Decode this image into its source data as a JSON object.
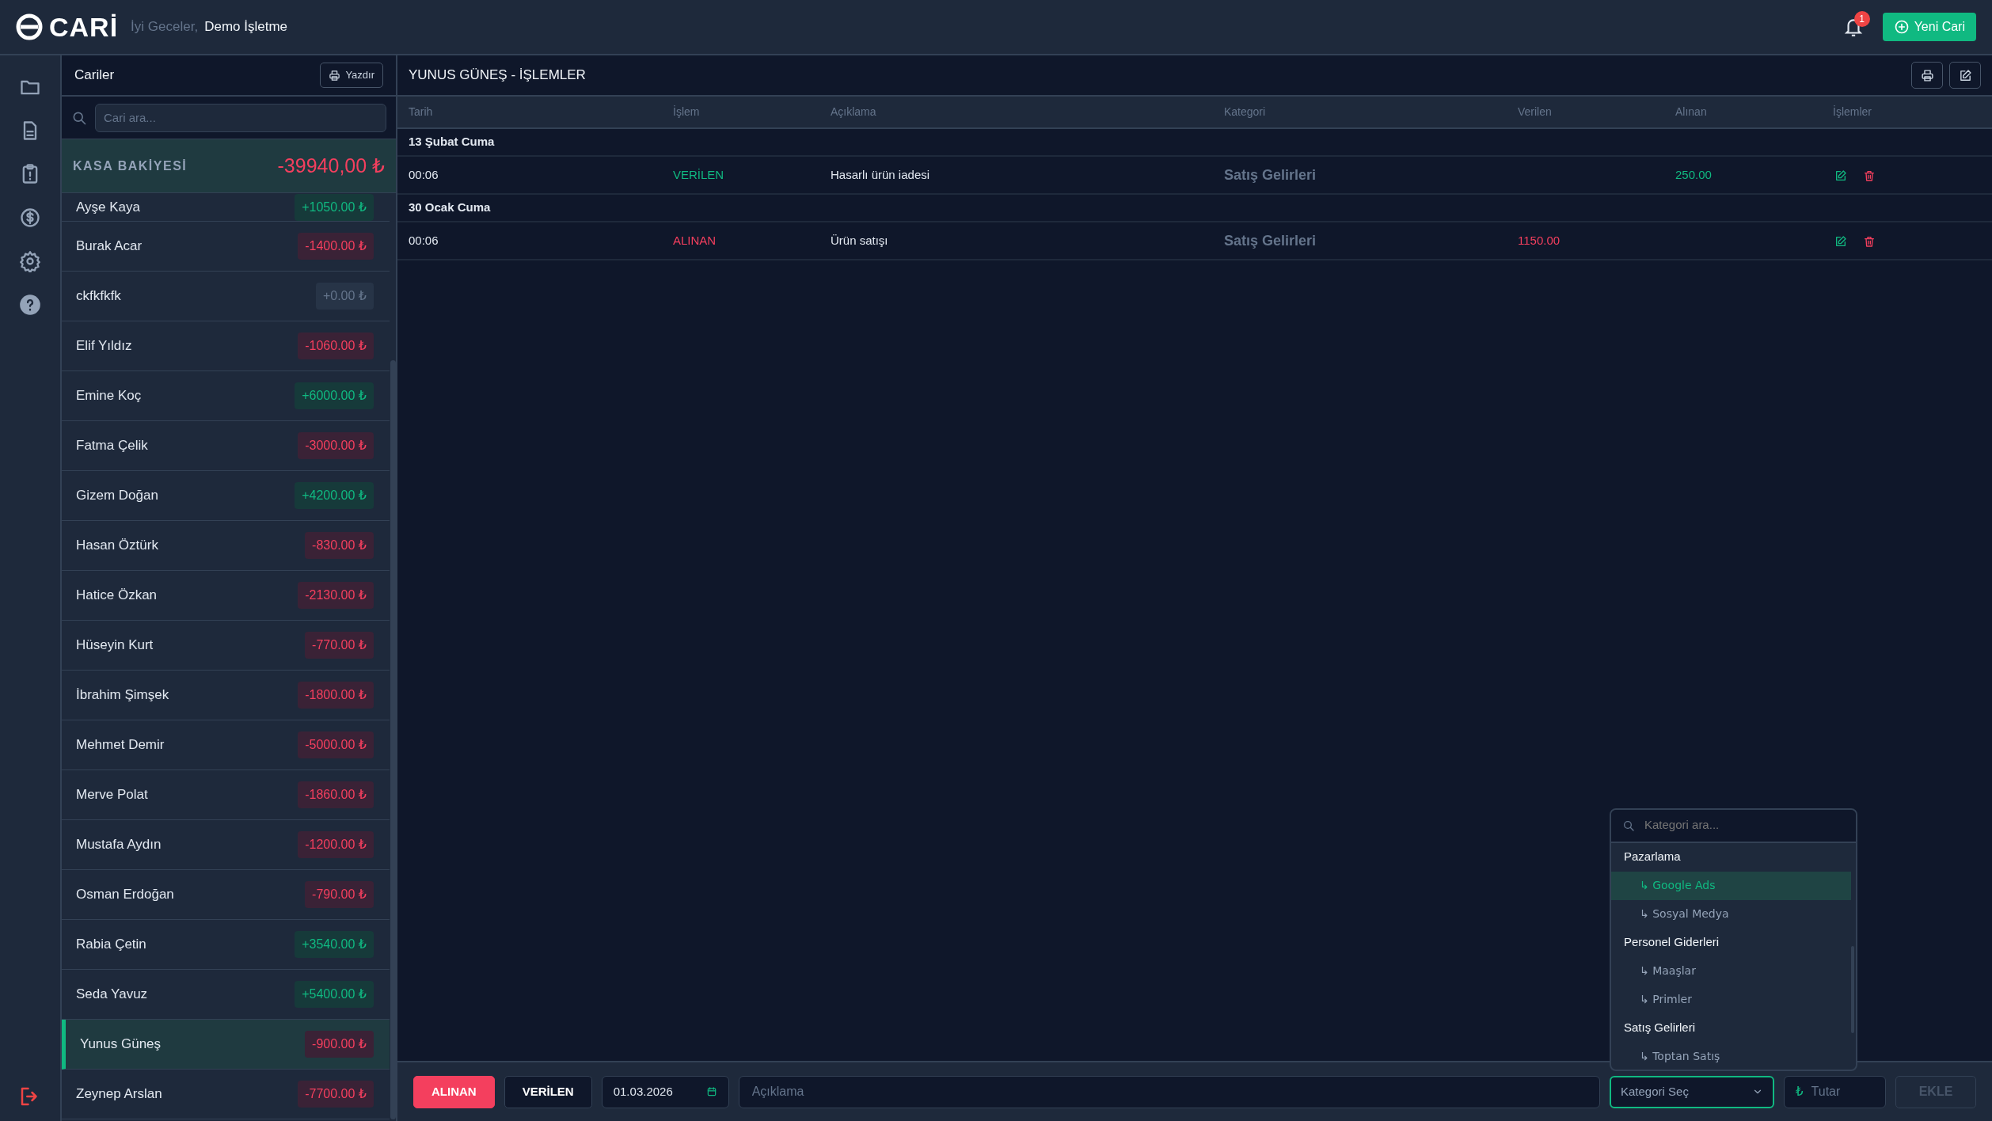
{
  "header": {
    "logo": "CARİ",
    "greeting": "İyi Geceler,",
    "business": "Demo İşletme",
    "notifications": "1",
    "new_button": "Yeni Cari"
  },
  "customers": {
    "title": "Cariler",
    "print_button": "Yazdır",
    "search": {
      "placeholder": "Cari ara..."
    },
    "balance_label": "KASA BAKİYESİ",
    "balance": "-39940,00 ₺",
    "balance_negative": true,
    "items": [
      {
        "name": "Ayşe Kaya",
        "amount": "+1050.00 ₺",
        "kind": "credit",
        "selected": false
      },
      {
        "name": "Burak Acar",
        "amount": "-1400.00 ₺",
        "kind": "debit",
        "selected": false
      },
      {
        "name": "ckfkfkfk",
        "amount": "+0.00 ₺",
        "kind": "zero",
        "selected": false
      },
      {
        "name": "Elif Yıldız",
        "amount": "-1060.00 ₺",
        "kind": "debit",
        "selected": false
      },
      {
        "name": "Emine Koç",
        "amount": "+6000.00 ₺",
        "kind": "credit",
        "selected": false
      },
      {
        "name": "Fatma Çelik",
        "amount": "-3000.00 ₺",
        "kind": "debit",
        "selected": false
      },
      {
        "name": "Gizem Doğan",
        "amount": "+4200.00 ₺",
        "kind": "credit",
        "selected": false
      },
      {
        "name": "Hasan Öztürk",
        "amount": "-830.00 ₺",
        "kind": "debit",
        "selected": false
      },
      {
        "name": "Hatice Özkan",
        "amount": "-2130.00 ₺",
        "kind": "debit",
        "selected": false
      },
      {
        "name": "Hüseyin Kurt",
        "amount": "-770.00 ₺",
        "kind": "debit",
        "selected": false
      },
      {
        "name": "İbrahim Şimşek",
        "amount": "-1800.00 ₺",
        "kind": "debit",
        "selected": false
      },
      {
        "name": "Mehmet Demir",
        "amount": "-5000.00 ₺",
        "kind": "debit",
        "selected": false
      },
      {
        "name": "Merve Polat",
        "amount": "-1860.00 ₺",
        "kind": "debit",
        "selected": false
      },
      {
        "name": "Mustafa Aydın",
        "amount": "-1200.00 ₺",
        "kind": "debit",
        "selected": false
      },
      {
        "name": "Osman Erdoğan",
        "amount": "-790.00 ₺",
        "kind": "debit",
        "selected": false
      },
      {
        "name": "Rabia Çetin",
        "amount": "+3540.00 ₺",
        "kind": "credit",
        "selected": false
      },
      {
        "name": "Seda Yavuz",
        "amount": "+5400.00 ₺",
        "kind": "credit",
        "selected": false
      },
      {
        "name": "Yunus Güneş",
        "amount": "-900.00 ₺",
        "kind": "debit",
        "selected": true
      },
      {
        "name": "Zeynep Arslan",
        "amount": "-7700.00 ₺",
        "kind": "debit",
        "selected": false
      }
    ]
  },
  "transactions": {
    "title": "YUNUS GÜNEŞ - İŞLEMLER",
    "columns": [
      "Tarih",
      "İşlem",
      "Açıklama",
      "Kategori",
      "Verilen",
      "Alınan",
      "İşlemler"
    ],
    "groups": [
      {
        "date": "13 Şubat Cuma",
        "rows": [
          {
            "time": "00:06",
            "type": "VERİLEN",
            "kind": "given",
            "description": "Hasarlı ürün iadesi",
            "category": "Satış Gelirleri",
            "received": "250.00"
          }
        ]
      },
      {
        "date": "30 Ocak Cuma",
        "rows": [
          {
            "time": "00:06",
            "type": "ALINAN",
            "kind": "received",
            "description": "Ürün satışı",
            "category": "Satış Gelirleri",
            "given": "1150.00"
          }
        ]
      }
    ]
  },
  "form": {
    "type_buttons": [
      {
        "label": "ALINAN",
        "kind": "received",
        "selected": true
      },
      {
        "label": "VERİLEN",
        "kind": "given",
        "selected": false
      }
    ],
    "date": "01.03.2026",
    "description": {
      "placeholder": "Açıklama"
    },
    "category_select": {
      "placeholder": "Kategori Seç",
      "open": true
    },
    "category_menu": {
      "search": {
        "placeholder": "Kategori ara..."
      },
      "groups": [
        {
          "label": "Pazarlama",
          "children": [
            {
              "label": "↳ Google Ads",
              "selected": true
            },
            {
              "label": "↳ Sosyal Medya",
              "selected": false
            }
          ]
        },
        {
          "label": "Personel Giderleri",
          "children": [
            {
              "label": "↳ Maaşlar",
              "selected": false
            },
            {
              "label": "↳ Primler",
              "selected": false
            }
          ]
        },
        {
          "label": "Satış Gelirleri",
          "children": [
            {
              "label": "↳ Toptan Satış",
              "selected": false
            }
          ]
        }
      ]
    },
    "amount": {
      "currency": "₺",
      "placeholder": "Tutar"
    },
    "add_button": {
      "label": "EKLE",
      "disabled": true
    }
  }
}
